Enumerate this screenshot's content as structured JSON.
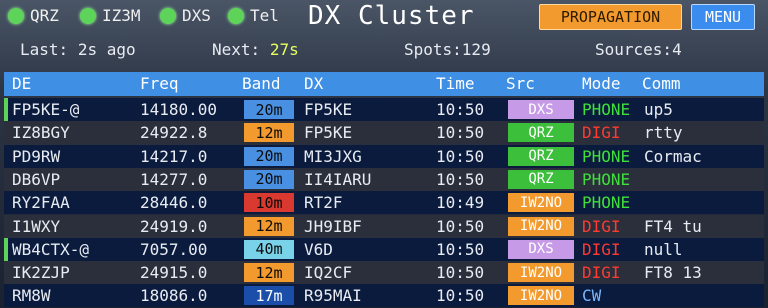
{
  "sources": [
    {
      "label": "QRZ"
    },
    {
      "label": "IZ3M"
    },
    {
      "label": "DXS"
    },
    {
      "label": "Tel"
    }
  ],
  "title": "DX Cluster",
  "buttons": {
    "propagation": "PROPAGATION",
    "menu": "MENU"
  },
  "stats": {
    "last_label": "Last:",
    "last_value": "2s ago",
    "next_label": "Next:",
    "next_value": "27s",
    "spots": "Spots:129",
    "sources_count": "Sources:4"
  },
  "columns": {
    "de": "DE",
    "freq": "Freq",
    "band": "Band",
    "dx": "DX",
    "time": "Time",
    "src": "Src",
    "mode": "Mode",
    "comm": "Comm"
  },
  "colors": {
    "band": {
      "20m": "#4a90e2",
      "12m": "#f39a2e",
      "10m": "#d9392e",
      "40m": "#79d2e8",
      "17m": "#1a4ea8"
    },
    "src": {
      "DXS": "#c79ae8",
      "QRZ": "#3cbf3a",
      "IW2NO": "#f39a2e"
    },
    "mode": {
      "PHONE": "#3ee03a",
      "DIGI": "#ff3b30",
      "CW": "#79b8ff"
    }
  },
  "spots": [
    {
      "de": "FP5KE-@",
      "freq": "14180.00",
      "band": "20m",
      "dx": "FP5KE",
      "time": "10:50",
      "src": "DXS",
      "mode": "PHONE",
      "comm": "up5",
      "accent": true
    },
    {
      "de": "IZ8BGY",
      "freq": "24922.8",
      "band": "12m",
      "dx": "FP5KE",
      "time": "10:50",
      "src": "QRZ",
      "mode": "DIGI",
      "comm": "rtty",
      "accent": false
    },
    {
      "de": "PD9RW",
      "freq": "14217.0",
      "band": "20m",
      "dx": "MI3JXG",
      "time": "10:50",
      "src": "QRZ",
      "mode": "PHONE",
      "comm": "Cormac",
      "accent": false
    },
    {
      "de": "DB6VP",
      "freq": "14277.0",
      "band": "20m",
      "dx": "II4IARU",
      "time": "10:50",
      "src": "QRZ",
      "mode": "PHONE",
      "comm": "",
      "accent": false
    },
    {
      "de": "RY2FAA",
      "freq": "28446.0",
      "band": "10m",
      "dx": "RT2F",
      "time": "10:49",
      "src": "IW2NO",
      "mode": "PHONE",
      "comm": "",
      "accent": false
    },
    {
      "de": "I1WXY",
      "freq": "24919.0",
      "band": "12m",
      "dx": "JH9IBF",
      "time": "10:50",
      "src": "IW2NO",
      "mode": "DIGI",
      "comm": "FT4 tu",
      "accent": false
    },
    {
      "de": "WB4CTX-@",
      "freq": "7057.00",
      "band": "40m",
      "dx": "V6D",
      "time": "10:50",
      "src": "DXS",
      "mode": "DIGI",
      "comm": "null",
      "accent": true
    },
    {
      "de": "IK2ZJP",
      "freq": "24915.0",
      "band": "12m",
      "dx": "IQ2CF",
      "time": "10:50",
      "src": "IW2NO",
      "mode": "DIGI",
      "comm": "FT8 13",
      "accent": false
    },
    {
      "de": "RM8W",
      "freq": "18086.0",
      "band": "17m",
      "dx": "R95MAI",
      "time": "10:50",
      "src": "IW2NO",
      "mode": "CW",
      "comm": "",
      "accent": false
    }
  ]
}
